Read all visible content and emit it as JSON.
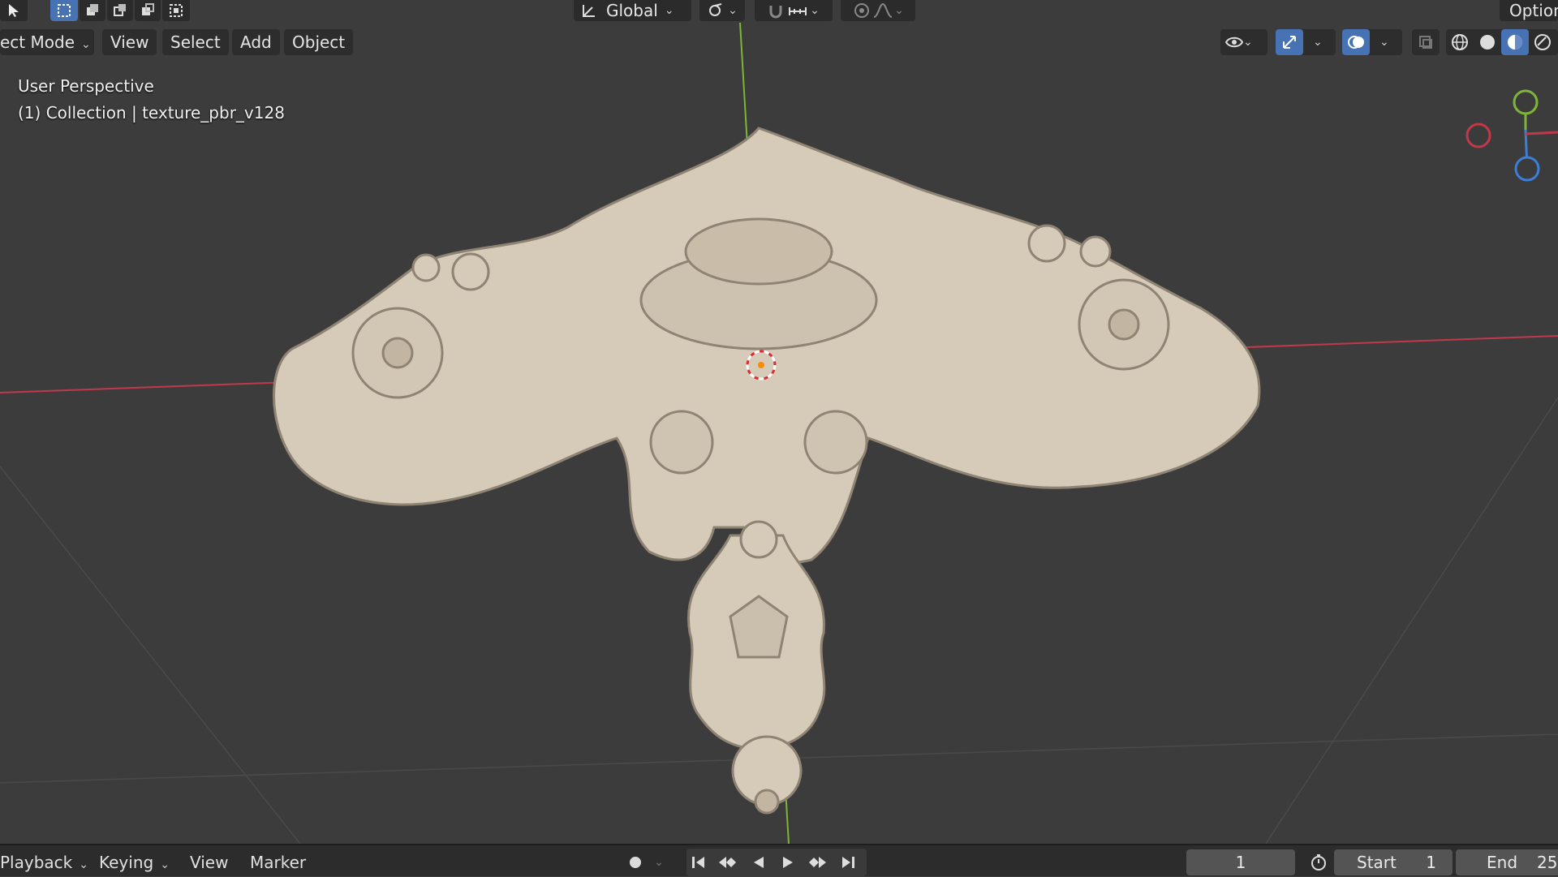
{
  "header": {
    "mode_label": "ect Mode",
    "menu": [
      "View",
      "Select",
      "Add",
      "Object"
    ],
    "transform_orientation": "Global",
    "options_label": "Option"
  },
  "viewport": {
    "perspective_label": "User Perspective",
    "collection_label": "(1) Collection | texture_pbr_v128"
  },
  "timeline": {
    "menu": [
      "Playback",
      "Keying",
      "View",
      "Marker"
    ],
    "current_frame": "1",
    "start_label": "Start",
    "start_value": "1",
    "end_label": "End",
    "end_value": "25"
  },
  "colors": {
    "accent": "#4772b3",
    "x_axis": "#c0394b",
    "y_axis": "#7fb43a",
    "z_axis": "#3b7fd9",
    "model": "#d6cbb9"
  },
  "icons": {
    "select_tool": "cursor-arrow-icon",
    "select_box_modes": [
      "select-new-icon",
      "select-extend-icon",
      "select-subtract-icon",
      "select-invert-icon",
      "select-intersect-icon"
    ],
    "orientation": "orientation-icon",
    "pivot": "pivot-point-icon",
    "snap": "magnet-icon",
    "snap_increment": "snap-increment-icon",
    "proportional": "proportional-edit-icon",
    "falloff": "falloff-curve-icon",
    "visibility": "eye-icon",
    "gizmo": "gizmo-icon",
    "overlay": "overlay-icon",
    "xray": "xray-icon",
    "shading": [
      "wireframe-icon",
      "solid-icon",
      "material-preview-icon",
      "rendered-icon"
    ],
    "record": "record-icon",
    "transport": [
      "jump-start-icon",
      "prev-keyframe-icon",
      "play-reverse-icon",
      "play-icon",
      "next-keyframe-icon",
      "jump-end-icon"
    ],
    "clock": "stopwatch-icon"
  }
}
